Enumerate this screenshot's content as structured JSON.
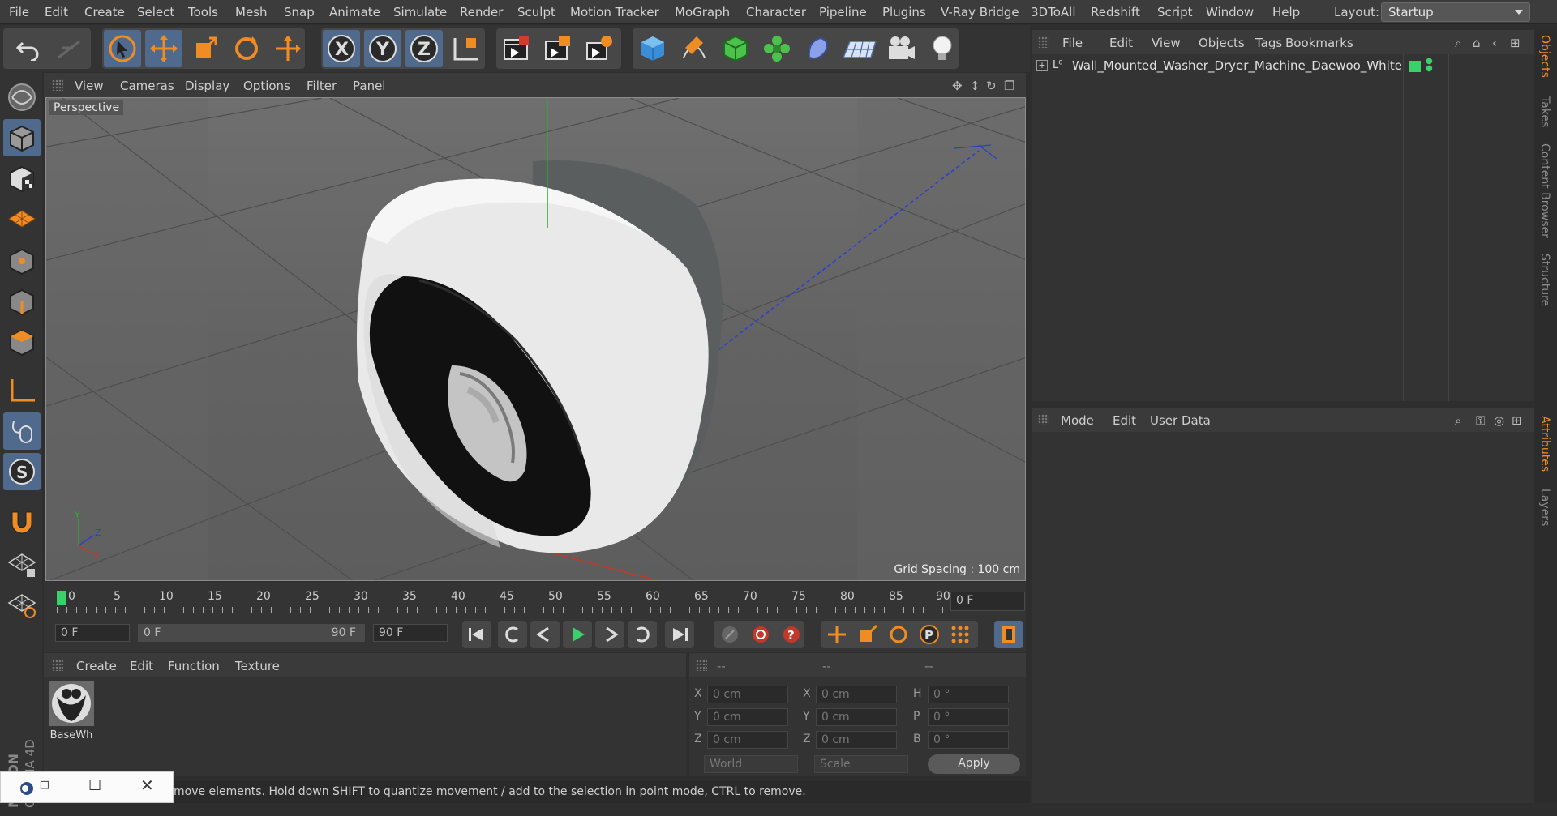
{
  "menubar": {
    "items": [
      "File",
      "Edit",
      "Create",
      "Select",
      "Tools",
      "Mesh",
      "Snap",
      "Animate",
      "Simulate",
      "Render",
      "Sculpt",
      "Motion Tracker",
      "MoGraph",
      "Character",
      "Pipeline",
      "Plugins",
      "V-Ray Bridge",
      "3DToAll",
      "Redshift",
      "Script",
      "Window",
      "Help"
    ],
    "layout_label": "Layout:",
    "layout_value": "Startup"
  },
  "toolbar": {
    "icons": [
      "undo-icon",
      "redo-icon",
      "select-arrow-icon",
      "move-icon",
      "scale-icon",
      "rotate-icon",
      "transform-icon",
      "x-axis-icon",
      "y-axis-icon",
      "z-axis-icon",
      "world-coordinate-icon",
      "render-view-icon",
      "render-picture-viewer-icon",
      "render-settings-icon",
      "cube-icon",
      "pen-spline-icon",
      "subdivision-icon",
      "cloner-icon",
      "deformer-icon",
      "floor-icon",
      "camera-icon",
      "light-icon"
    ]
  },
  "left_toolbar": {
    "icons": [
      "make-editable-icon",
      "model-mode-icon",
      "texture-mode-icon",
      "workplane-icon",
      "points-mode-icon",
      "edges-mode-icon",
      "polygons-mode-icon",
      "axis-mode-icon",
      "tweak-mode-icon",
      "solo-mode-icon",
      "snapping-icon",
      "workplane-lock-icon",
      "planar-workplane-icon"
    ]
  },
  "viewport": {
    "menu": [
      "View",
      "Cameras",
      "Display",
      "Options",
      "Filter",
      "Panel"
    ],
    "label": "Perspective",
    "grid_spacing": "Grid Spacing : 100 cm"
  },
  "timeline": {
    "ticks": [
      "0",
      "5",
      "10",
      "15",
      "20",
      "25",
      "30",
      "35",
      "40",
      "45",
      "50",
      "55",
      "60",
      "65",
      "70",
      "75",
      "80",
      "85",
      "90"
    ],
    "current_frame": "0 F"
  },
  "transport": {
    "start": "0 F",
    "range_start": "0 F",
    "range_end": "90 F",
    "end": "90 F"
  },
  "materials": {
    "menu": [
      "Create",
      "Edit",
      "Function",
      "Texture"
    ],
    "items": [
      {
        "name": "BaseWh"
      }
    ]
  },
  "coordinates": {
    "headers": [
      "--",
      "--",
      "--"
    ],
    "rows": [
      {
        "l1": "X",
        "v1": "0 cm",
        "l2": "X",
        "v2": "0 cm",
        "l3": "H",
        "v3": "0 °"
      },
      {
        "l1": "Y",
        "v1": "0 cm",
        "l2": "Y",
        "v2": "0 cm",
        "l3": "P",
        "v3": "0 °"
      },
      {
        "l1": "Z",
        "v1": "0 cm",
        "l2": "Z",
        "v2": "0 cm",
        "l3": "B",
        "v3": "0 °"
      }
    ],
    "mode1": "World",
    "mode2": "Scale",
    "apply": "Apply"
  },
  "status": {
    "text": "move elements. Hold down SHIFT to quantize movement / add to the selection in point mode, CTRL to remove."
  },
  "objects": {
    "menu": [
      "File",
      "Edit",
      "View",
      "Objects",
      "Tags",
      "Bookmarks"
    ],
    "items": [
      {
        "name": "Wall_Mounted_Washer_Dryer_Machine_Daewoo_White"
      }
    ]
  },
  "attributes": {
    "menu": [
      "Mode",
      "Edit",
      "User Data"
    ]
  },
  "right_tabs": [
    "Objects",
    "Takes",
    "Content Browser",
    "Structure",
    "Attributes",
    "Layers"
  ],
  "brand": {
    "line1": "MAXON",
    "line2": "CINEMA 4D"
  },
  "colors": {
    "accent_blue": "#4f6a8c",
    "orange": "#f08c24",
    "axis_green": "#2fa832",
    "axis_red": "#c0392b",
    "axis_blue": "#2a3fd0"
  }
}
